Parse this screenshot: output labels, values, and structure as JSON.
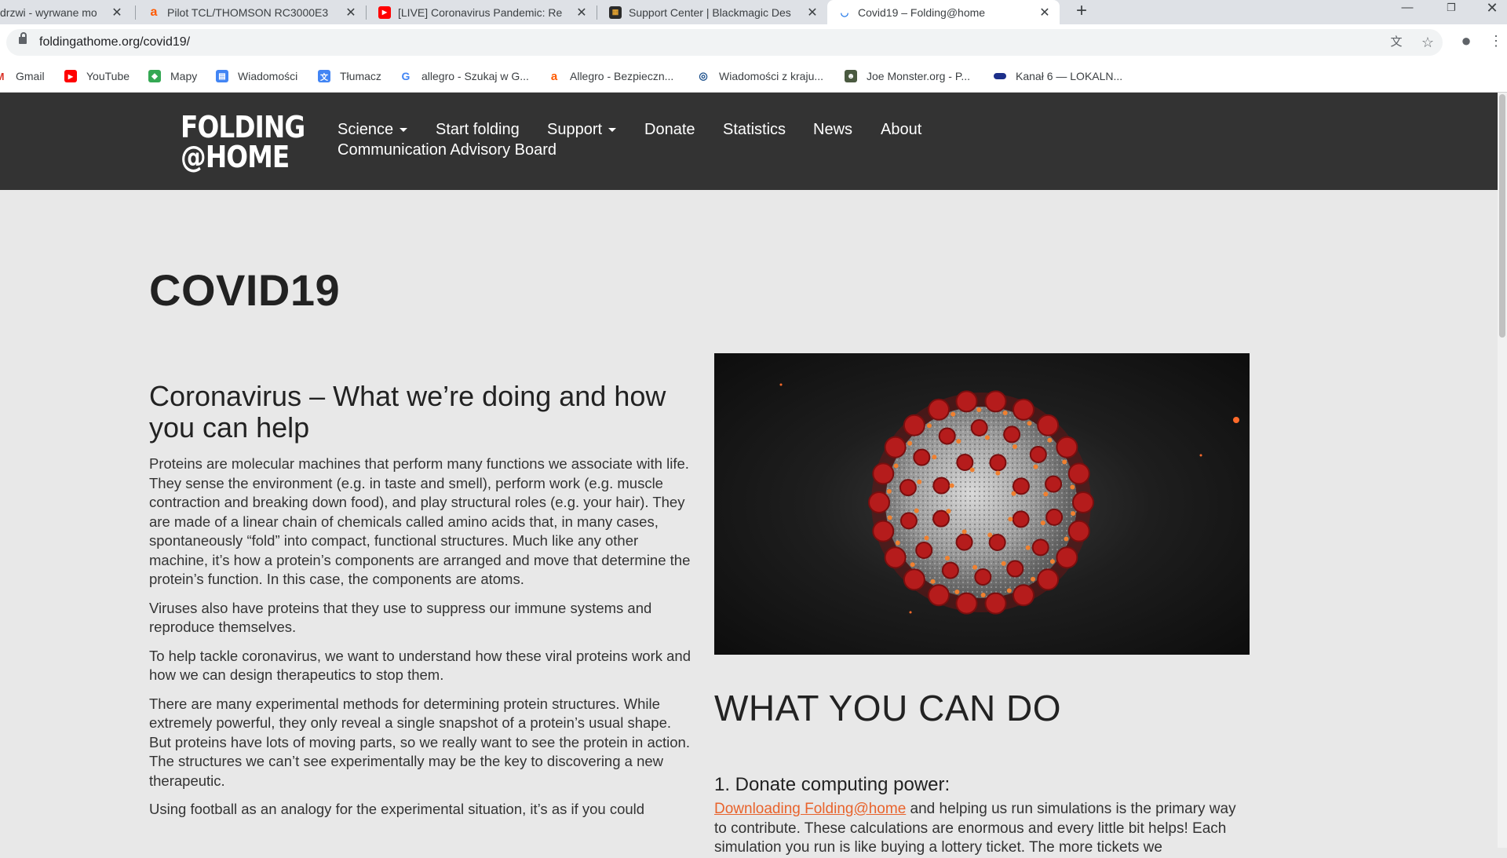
{
  "tabs": [
    {
      "title": "drzwi - wyrwane mo"
    },
    {
      "title": "Pilot TCL/THOMSON RC3000E3"
    },
    {
      "title": "[LIVE] Coronavirus Pandemic: Re"
    },
    {
      "title": "Support Center | Blackmagic Des"
    },
    {
      "title": "Covid19 – Folding@home"
    }
  ],
  "address": {
    "url": "foldingathome.org/covid19/"
  },
  "bookmarks": [
    {
      "label": "Gmail"
    },
    {
      "label": "YouTube"
    },
    {
      "label": "Mapy"
    },
    {
      "label": "Wiadomości"
    },
    {
      "label": "Tłumacz"
    },
    {
      "label": "allegro - Szukaj w G..."
    },
    {
      "label": "Allegro - Bezpieczn..."
    },
    {
      "label": "Wiadomości z kraju..."
    },
    {
      "label": "Joe Monster.org - P..."
    },
    {
      "label": "Kanał 6 — LOKALN..."
    }
  ],
  "site": {
    "logo_line1": "FOLDING",
    "logo_line2": "@HOME",
    "nav": [
      {
        "label": "Science"
      },
      {
        "label": "Start folding"
      },
      {
        "label": "Support"
      },
      {
        "label": "Donate"
      },
      {
        "label": "Statistics"
      },
      {
        "label": "News"
      },
      {
        "label": "About"
      },
      {
        "label": "Communication Advisory Board"
      }
    ]
  },
  "content": {
    "page_title": "COVID19",
    "heading": "Coronavirus – What we’re doing and how you can help",
    "paragraphs": [
      "Proteins are molecular machines that perform many functions we associate with life. They sense the environment (e.g. in taste and smell), perform work (e.g. muscle contraction and breaking down food), and play structural roles (e.g. your hair). They are made of a linear chain of chemicals called amino acids that, in many cases, spontaneously “fold” into compact, functional structures. Much like any other machine, it’s how a protein’s components are arranged and move that determine the protein’s function. In this case, the components are atoms.",
      "Viruses also have proteins that they use to suppress our immune systems and reproduce themselves.",
      "To help tackle coronavirus, we want to understand how these viral proteins work and how we can design therapeutics to stop them.",
      "There are many experimental methods for determining protein structures. While extremely powerful, they only reveal a single snapshot of a protein’s usual shape. But proteins have lots of moving parts, so we really want to see the protein in action. The structures we can’t see experimentally may be the key to discovering a new therapeutic.",
      "Using football as an analogy for the experimental situation, it’s as if you could"
    ],
    "what_heading": "WHAT YOU CAN DO",
    "donate_heading": "1. Donate computing power:",
    "donate_link": "Downloading Folding@home",
    "donate_text": " and helping us run simulations is the primary way to contribute. These calculations are enormous and every little bit helps! Each simulation you run is like buying a lottery ticket. The more tickets we"
  },
  "colors": {
    "header_bg": "#333333",
    "page_bg": "#e8e8e8",
    "link": "#e8632c"
  }
}
